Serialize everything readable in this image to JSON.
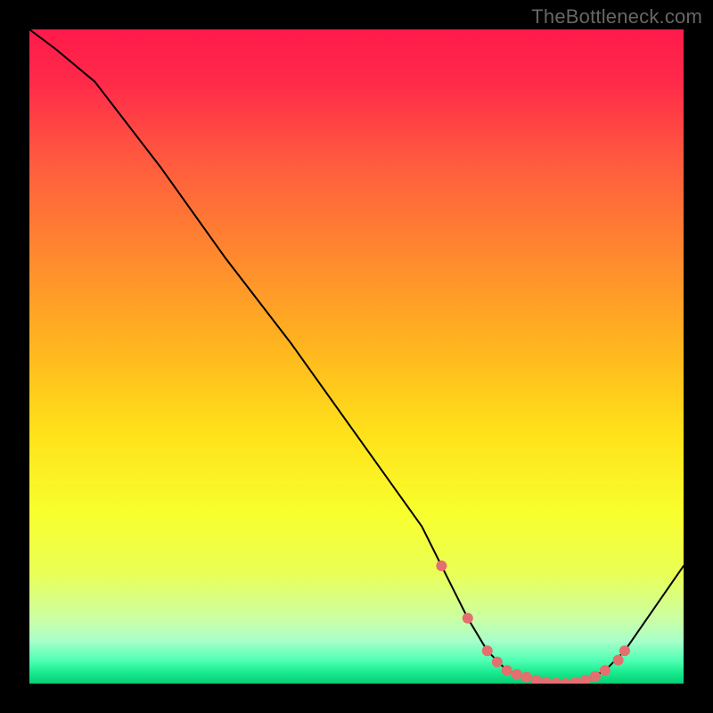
{
  "watermark": "TheBottleneck.com",
  "chart_data": {
    "type": "line",
    "title": "",
    "xlabel": "",
    "ylabel": "",
    "xlim": [
      0,
      100
    ],
    "ylim": [
      0,
      100
    ],
    "series": [
      {
        "name": "bottleneck-curve",
        "x": [
          0,
          4,
          10,
          20,
          30,
          40,
          50,
          60,
          63,
          67,
          70,
          73,
          76,
          79,
          82,
          85,
          88,
          91,
          100
        ],
        "y": [
          100,
          97,
          92,
          79,
          65,
          52,
          38,
          24,
          18,
          10,
          5,
          2,
          1,
          0.2,
          0,
          0.5,
          2,
          5,
          18
        ]
      }
    ],
    "markers": {
      "name": "highlight-range",
      "x": [
        63,
        67,
        70,
        71.5,
        73,
        74.5,
        76,
        77.5,
        79,
        80.5,
        82,
        83.5,
        85,
        86.5,
        88,
        90,
        91
      ],
      "y": [
        18,
        10,
        5,
        3.3,
        2,
        1.4,
        1,
        0.5,
        0.2,
        0.08,
        0,
        0.2,
        0.5,
        1.1,
        2,
        3.6,
        5
      ]
    },
    "marker_style": {
      "color": "#e36f6f",
      "radius": 6
    },
    "line_style": {
      "color": "#000000",
      "width": 2
    },
    "background_gradient": {
      "stops": [
        {
          "pos": 0.0,
          "color": "#ff1a4b"
        },
        {
          "pos": 0.08,
          "color": "#ff2a49"
        },
        {
          "pos": 0.2,
          "color": "#ff5a3f"
        },
        {
          "pos": 0.35,
          "color": "#ff8a2e"
        },
        {
          "pos": 0.5,
          "color": "#ffba1e"
        },
        {
          "pos": 0.62,
          "color": "#ffe21a"
        },
        {
          "pos": 0.74,
          "color": "#f8ff2e"
        },
        {
          "pos": 0.83,
          "color": "#eaff55"
        },
        {
          "pos": 0.9,
          "color": "#ccffa3"
        },
        {
          "pos": 0.935,
          "color": "#a8ffca"
        },
        {
          "pos": 0.965,
          "color": "#4dffb3"
        },
        {
          "pos": 0.985,
          "color": "#15e88a"
        },
        {
          "pos": 1.0,
          "color": "#0acc74"
        }
      ]
    }
  }
}
